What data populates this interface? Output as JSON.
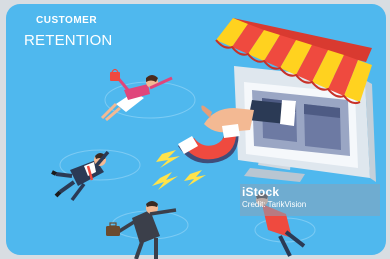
{
  "heading": {
    "line1": "CUSTOMER",
    "line2": "RETENTION"
  },
  "watermark": {
    "brand": "iStock",
    "credit": "Credit: TarikVision"
  },
  "colors": {
    "background": "#4fb8ee",
    "awning_red": "#ef4a3f",
    "awning_yellow": "#ffd21f",
    "monitor_body": "#dfe7ee",
    "lightning": "#ffe34a"
  },
  "icons": [
    "magnet-icon",
    "lightning-icon",
    "storefront-awning-icon",
    "computer-monitor-icon",
    "shopping-bag-icon",
    "briefcase-icon"
  ]
}
